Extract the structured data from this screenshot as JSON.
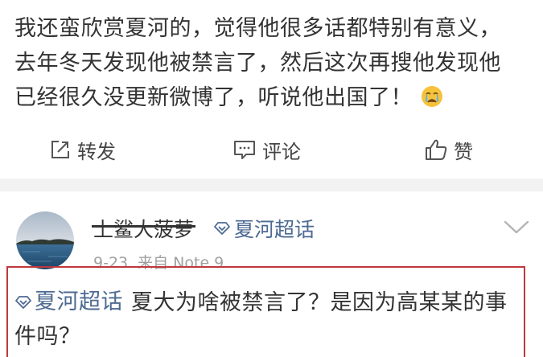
{
  "post": {
    "lines": [
      "我还蛮欣赏夏河的，觉得他很多话都特别有意义，",
      "去年冬天发现他被禁言了，然后这次再搜他发现他",
      "已经很久没更新微博了，听说他出国了！"
    ],
    "emoji_icon": "crying-face-emoji"
  },
  "actions": {
    "repost_label": "转发",
    "comment_label": "评论",
    "like_label": "赞"
  },
  "reply": {
    "username": "上鲨大菠萝",
    "topic": "夏河超话",
    "timestamp": "9-23",
    "source": "来自 Note 9",
    "comment_topic": "夏河超话",
    "comment_lines": [
      "夏大为啥被禁言了？是因为高某某的事",
      "件吗？"
    ]
  },
  "colors": {
    "link": "#4d6a92",
    "highlight_border": "#c0383c",
    "separator": "#f2f2f2",
    "meta_text": "#a0a0a0"
  }
}
